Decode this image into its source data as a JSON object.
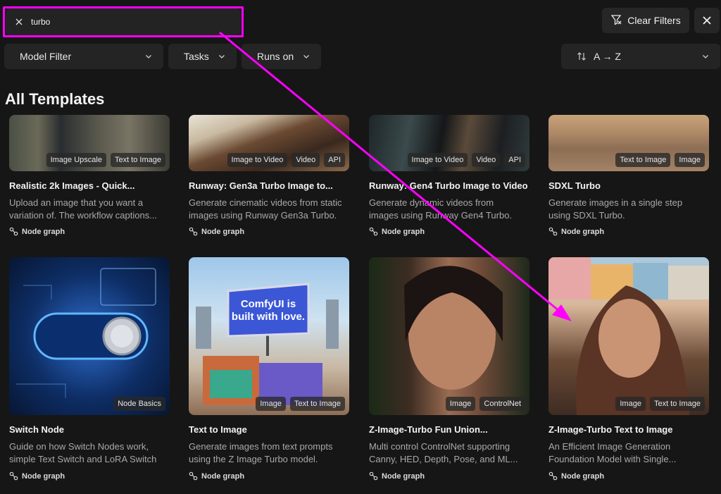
{
  "search": {
    "value": "turbo"
  },
  "toolbar": {
    "clear_filters": "Clear Filters"
  },
  "filters": {
    "model": "Model Filter",
    "tasks": "Tasks",
    "runs_on": "Runs on",
    "sort": "A → Z"
  },
  "section_title": "All Templates",
  "cards": [
    {
      "title": "Realistic 2k Images - Quick...",
      "desc": "Upload an image that you want a\nvariation of. The workflow captions...",
      "footer": "Node graph",
      "tags": [
        "Image Upscale",
        "Text to Image"
      ]
    },
    {
      "title": "Runway: Gen3a Turbo Image to...",
      "desc": "Generate cinematic videos from static\nimages using Runway Gen3a Turbo.",
      "footer": "Node graph",
      "tags": [
        "Image to Video",
        "Video",
        "API"
      ]
    },
    {
      "title": "Runway: Gen4 Turbo Image to Video",
      "desc": "Generate dynamic videos from\nimages using Runway Gen4 Turbo.",
      "footer": "Node graph",
      "tags": [
        "Image to Video",
        "Video",
        "API"
      ]
    },
    {
      "title": "SDXL Turbo",
      "desc": "Generate images in a single step\nusing SDXL Turbo.",
      "footer": "Node graph",
      "tags": [
        "Text to Image",
        "Image"
      ]
    },
    {
      "title": "Switch Node",
      "desc": "Guide on how Switch Nodes work,\nsimple Text Switch and LoRA Switch",
      "footer": "Node graph",
      "tags": [
        "Node Basics"
      ]
    },
    {
      "title": "Text to Image",
      "desc": "Generate images from text prompts\nusing the Z Image Turbo model.",
      "footer": "Node graph",
      "tags": [
        "Image",
        "Text to Image"
      ]
    },
    {
      "title": "Z-Image-Turbo Fun Union...",
      "desc": "Multi control ControlNet supporting\nCanny, HED, Depth, Pose, and ML...",
      "footer": "Node graph",
      "tags": [
        "Image",
        "ControlNet"
      ]
    },
    {
      "title": "Z-Image-Turbo Text to Image",
      "desc": "An Efficient Image Generation\nFoundation Model with Single...",
      "footer": "Node graph",
      "tags": [
        "Image",
        "Text to Image"
      ]
    }
  ],
  "billboard": {
    "line1": "ComfyUI is",
    "line2": "built with love."
  },
  "colors": {
    "annotation": "#ff00ff",
    "background": "#161616"
  }
}
